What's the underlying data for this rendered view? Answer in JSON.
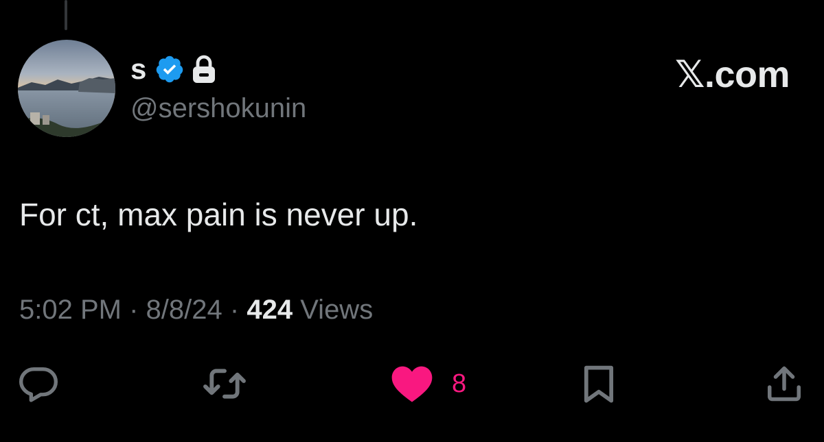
{
  "tweet": {
    "author": {
      "display_name": "s",
      "handle": "@sershokunin",
      "verified_icon": "verified-badge-icon",
      "protected_icon": "lock-icon"
    },
    "brand": "𝕏.com",
    "text": "For ct, max pain is never up.",
    "time": "5:02 PM",
    "date": "8/8/24",
    "separator": "·",
    "views_count": "424",
    "views_label": "Views"
  },
  "actions": {
    "reply_icon": "reply-icon",
    "retweet_icon": "retweet-icon",
    "like_icon": "heart-icon",
    "like_count": "8",
    "bookmark_icon": "bookmark-icon",
    "share_icon": "share-icon"
  },
  "colors": {
    "background": "#000000",
    "primary_text": "#e7e9ea",
    "secondary_text": "#71767b",
    "verified_blue": "#1d9bf0",
    "like_pink": "#f91880"
  }
}
